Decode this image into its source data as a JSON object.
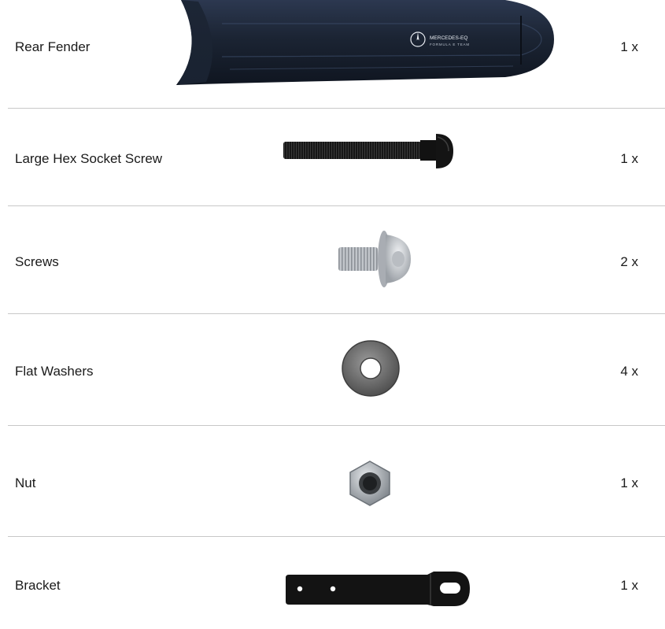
{
  "parts": [
    {
      "name": "Rear Fender",
      "qty": "1 x",
      "image_icon": "rear-fender-image",
      "logo": {
        "brand": "MERCEDES-EQ",
        "sub": "FORMULA E TEAM"
      }
    },
    {
      "name": "Large Hex Socket Screw",
      "qty": "1 x",
      "image_icon": "hex-socket-screw-image"
    },
    {
      "name": "Screws",
      "qty": "2 x",
      "image_icon": "flange-screw-image"
    },
    {
      "name": "Flat Washers",
      "qty": "4 x",
      "image_icon": "flat-washer-image"
    },
    {
      "name": "Nut",
      "qty": "1 x",
      "image_icon": "hex-nut-image"
    },
    {
      "name": "Bracket",
      "qty": "1 x",
      "image_icon": "bracket-image"
    }
  ],
  "colors": {
    "text": "#1a1a1a",
    "divider": "#c8c8c8",
    "fender": "#1b2433",
    "black_metal": "#141414",
    "zinc": "#c9ccd0",
    "washer": "#6a6a6a"
  }
}
